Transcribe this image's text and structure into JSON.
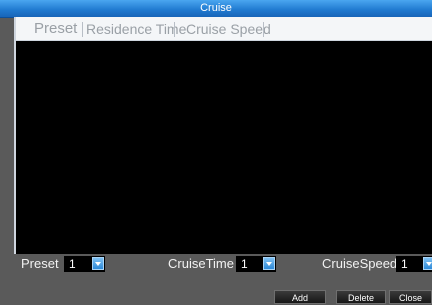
{
  "window": {
    "title": "Cruise"
  },
  "table": {
    "columns": [
      "Preset",
      "Residence Time",
      "Cruise Speed"
    ]
  },
  "controls": {
    "preset_label": "Preset",
    "preset_value": "1",
    "cruise_time_label": "CruiseTime",
    "cruise_time_value": "1",
    "cruise_speed_label": "CruiseSpeed",
    "cruise_speed_value": "1"
  },
  "buttons": {
    "add": "Add",
    "delete": "Delete",
    "close": "Close"
  },
  "icons": {
    "dropdown": "chevron-down-icon"
  },
  "colors": {
    "titlebar": "#1f79cf",
    "background": "#5a5a5a",
    "list_bg": "#000000",
    "dropdown_accent": "#2d8ad8"
  }
}
